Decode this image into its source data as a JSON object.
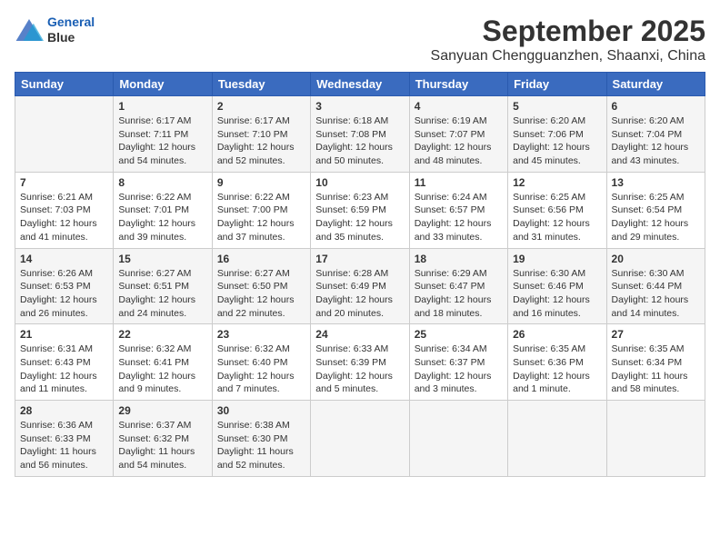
{
  "logo": {
    "line1": "General",
    "line2": "Blue"
  },
  "title": "September 2025",
  "location": "Sanyuan Chengguanzhen, Shaanxi, China",
  "days_of_week": [
    "Sunday",
    "Monday",
    "Tuesday",
    "Wednesday",
    "Thursday",
    "Friday",
    "Saturday"
  ],
  "weeks": [
    [
      {
        "day": "",
        "info": ""
      },
      {
        "day": "1",
        "info": "Sunrise: 6:17 AM\nSunset: 7:11 PM\nDaylight: 12 hours\nand 54 minutes."
      },
      {
        "day": "2",
        "info": "Sunrise: 6:17 AM\nSunset: 7:10 PM\nDaylight: 12 hours\nand 52 minutes."
      },
      {
        "day": "3",
        "info": "Sunrise: 6:18 AM\nSunset: 7:08 PM\nDaylight: 12 hours\nand 50 minutes."
      },
      {
        "day": "4",
        "info": "Sunrise: 6:19 AM\nSunset: 7:07 PM\nDaylight: 12 hours\nand 48 minutes."
      },
      {
        "day": "5",
        "info": "Sunrise: 6:20 AM\nSunset: 7:06 PM\nDaylight: 12 hours\nand 45 minutes."
      },
      {
        "day": "6",
        "info": "Sunrise: 6:20 AM\nSunset: 7:04 PM\nDaylight: 12 hours\nand 43 minutes."
      }
    ],
    [
      {
        "day": "7",
        "info": "Sunrise: 6:21 AM\nSunset: 7:03 PM\nDaylight: 12 hours\nand 41 minutes."
      },
      {
        "day": "8",
        "info": "Sunrise: 6:22 AM\nSunset: 7:01 PM\nDaylight: 12 hours\nand 39 minutes."
      },
      {
        "day": "9",
        "info": "Sunrise: 6:22 AM\nSunset: 7:00 PM\nDaylight: 12 hours\nand 37 minutes."
      },
      {
        "day": "10",
        "info": "Sunrise: 6:23 AM\nSunset: 6:59 PM\nDaylight: 12 hours\nand 35 minutes."
      },
      {
        "day": "11",
        "info": "Sunrise: 6:24 AM\nSunset: 6:57 PM\nDaylight: 12 hours\nand 33 minutes."
      },
      {
        "day": "12",
        "info": "Sunrise: 6:25 AM\nSunset: 6:56 PM\nDaylight: 12 hours\nand 31 minutes."
      },
      {
        "day": "13",
        "info": "Sunrise: 6:25 AM\nSunset: 6:54 PM\nDaylight: 12 hours\nand 29 minutes."
      }
    ],
    [
      {
        "day": "14",
        "info": "Sunrise: 6:26 AM\nSunset: 6:53 PM\nDaylight: 12 hours\nand 26 minutes."
      },
      {
        "day": "15",
        "info": "Sunrise: 6:27 AM\nSunset: 6:51 PM\nDaylight: 12 hours\nand 24 minutes."
      },
      {
        "day": "16",
        "info": "Sunrise: 6:27 AM\nSunset: 6:50 PM\nDaylight: 12 hours\nand 22 minutes."
      },
      {
        "day": "17",
        "info": "Sunrise: 6:28 AM\nSunset: 6:49 PM\nDaylight: 12 hours\nand 20 minutes."
      },
      {
        "day": "18",
        "info": "Sunrise: 6:29 AM\nSunset: 6:47 PM\nDaylight: 12 hours\nand 18 minutes."
      },
      {
        "day": "19",
        "info": "Sunrise: 6:30 AM\nSunset: 6:46 PM\nDaylight: 12 hours\nand 16 minutes."
      },
      {
        "day": "20",
        "info": "Sunrise: 6:30 AM\nSunset: 6:44 PM\nDaylight: 12 hours\nand 14 minutes."
      }
    ],
    [
      {
        "day": "21",
        "info": "Sunrise: 6:31 AM\nSunset: 6:43 PM\nDaylight: 12 hours\nand 11 minutes."
      },
      {
        "day": "22",
        "info": "Sunrise: 6:32 AM\nSunset: 6:41 PM\nDaylight: 12 hours\nand 9 minutes."
      },
      {
        "day": "23",
        "info": "Sunrise: 6:32 AM\nSunset: 6:40 PM\nDaylight: 12 hours\nand 7 minutes."
      },
      {
        "day": "24",
        "info": "Sunrise: 6:33 AM\nSunset: 6:39 PM\nDaylight: 12 hours\nand 5 minutes."
      },
      {
        "day": "25",
        "info": "Sunrise: 6:34 AM\nSunset: 6:37 PM\nDaylight: 12 hours\nand 3 minutes."
      },
      {
        "day": "26",
        "info": "Sunrise: 6:35 AM\nSunset: 6:36 PM\nDaylight: 12 hours\nand 1 minute."
      },
      {
        "day": "27",
        "info": "Sunrise: 6:35 AM\nSunset: 6:34 PM\nDaylight: 11 hours\nand 58 minutes."
      }
    ],
    [
      {
        "day": "28",
        "info": "Sunrise: 6:36 AM\nSunset: 6:33 PM\nDaylight: 11 hours\nand 56 minutes."
      },
      {
        "day": "29",
        "info": "Sunrise: 6:37 AM\nSunset: 6:32 PM\nDaylight: 11 hours\nand 54 minutes."
      },
      {
        "day": "30",
        "info": "Sunrise: 6:38 AM\nSunset: 6:30 PM\nDaylight: 11 hours\nand 52 minutes."
      },
      {
        "day": "",
        "info": ""
      },
      {
        "day": "",
        "info": ""
      },
      {
        "day": "",
        "info": ""
      },
      {
        "day": "",
        "info": ""
      }
    ]
  ]
}
